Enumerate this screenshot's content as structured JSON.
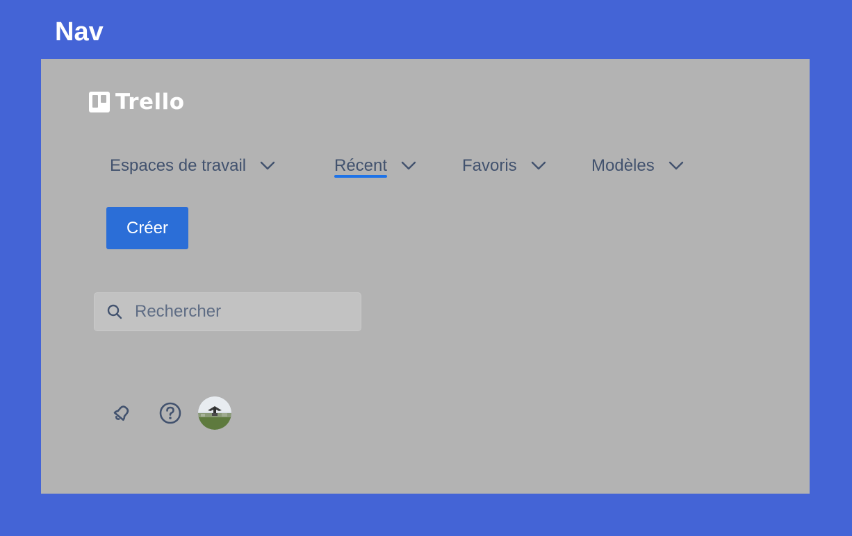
{
  "slide": {
    "title": "Nav"
  },
  "logo": {
    "text": "Trello",
    "icon": "trello-board-icon"
  },
  "menu": {
    "items": [
      {
        "label": "Espaces de travail",
        "icon": "chevron-down-icon",
        "active": false
      },
      {
        "label": "Récent",
        "icon": "chevron-down-icon",
        "active": true
      },
      {
        "label": "Favoris",
        "icon": "chevron-down-icon",
        "active": false
      },
      {
        "label": "Modèles",
        "icon": "chevron-down-icon",
        "active": false
      }
    ]
  },
  "create_button": {
    "label": "Créer"
  },
  "search": {
    "placeholder": "Rechercher",
    "value": "",
    "icon": "search-icon"
  },
  "actions": {
    "notifications_icon": "bell-icon",
    "help_icon": "help-circle-icon",
    "avatar": "user-avatar"
  },
  "colors": {
    "slide_background": "#4464D6",
    "panel_background": "#B3B3B3",
    "menu_text": "#42526E",
    "active_underline": "#1E73E8",
    "create_button": "#2B6ED7",
    "search_background": "#C2C2C2"
  }
}
